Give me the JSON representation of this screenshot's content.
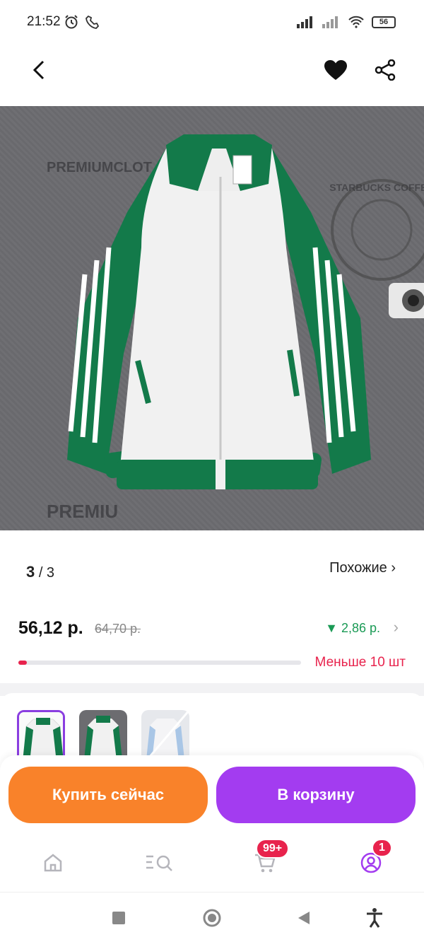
{
  "status": {
    "time": "21:52",
    "battery": "56"
  },
  "gallery": {
    "current": "3",
    "total": "/ 3",
    "similar_label": "Похожие ›"
  },
  "price": {
    "current": "56,12 р.",
    "old": "64,70 р.",
    "drop": "▼ 2,86 р.",
    "stock_text": "Меньше 10 шт",
    "stock_level_percent": 3
  },
  "image": {
    "watermark_top": "PREMIUMCLOT",
    "watermark_bottom": "PREMIU",
    "badge_text": "STARBUCKS COFFEE"
  },
  "actions": {
    "buy_now": "Купить сейчас",
    "add_to_cart": "В корзину"
  },
  "nav": {
    "cart_badge": "99+",
    "profile_badge": "1"
  },
  "colors": {
    "buy": "#f9822a",
    "cart": "#a33cf0",
    "accent_red": "#e8234d",
    "drop_green": "#1a9a55",
    "jacket_green": "#137a4a"
  }
}
